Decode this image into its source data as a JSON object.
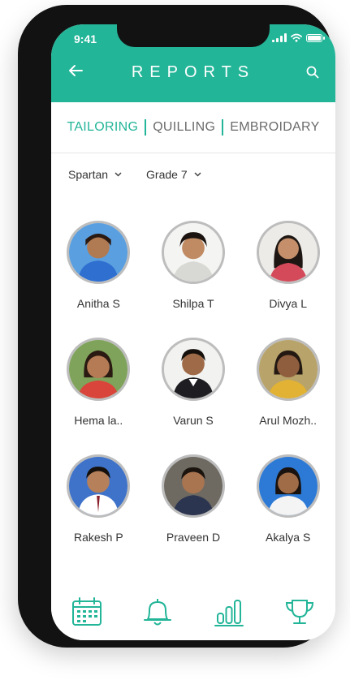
{
  "status": {
    "time": "9:41"
  },
  "header": {
    "title": "REPORTS"
  },
  "tabs": [
    {
      "label": "TAILORING",
      "active": true
    },
    {
      "label": "QUILLING",
      "active": false
    },
    {
      "label": "EMBROIDARY",
      "active": false
    }
  ],
  "filters": {
    "house": "Spartan",
    "grade": "Grade 7"
  },
  "students": [
    {
      "name": "Anitha S"
    },
    {
      "name": "Shilpa T"
    },
    {
      "name": "Divya L"
    },
    {
      "name": "Hema la.."
    },
    {
      "name": "Varun S"
    },
    {
      "name": "Arul Mozh.."
    },
    {
      "name": "Rakesh P"
    },
    {
      "name": "Praveen D"
    },
    {
      "name": "Akalya S"
    }
  ],
  "bottom_nav": [
    {
      "icon": "calendar-icon"
    },
    {
      "icon": "bell-icon"
    },
    {
      "icon": "bar-chart-icon"
    },
    {
      "icon": "trophy-icon"
    }
  ],
  "colors": {
    "accent": "#23b598"
  }
}
